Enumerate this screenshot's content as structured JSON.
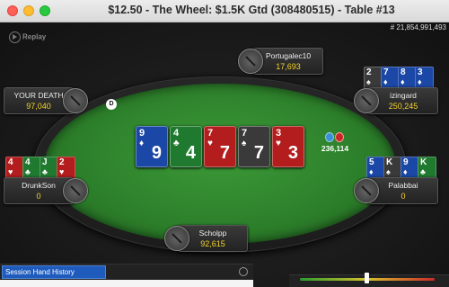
{
  "window": {
    "title": "$12.50 - The Wheel: $1.5K Gtd  (308480515) - Table #13",
    "hand_number": "# 21,854,991,493",
    "replay_label": "Replay"
  },
  "players": [
    {
      "name": "Portugalec10",
      "stack": "17,693"
    },
    {
      "name": "YOUR DEATH",
      "stack": "97,040"
    },
    {
      "name": "izingard",
      "stack": "250,245",
      "cards": [
        {
          "rank": "2",
          "suit": "spade"
        },
        {
          "rank": "7",
          "suit": "diamond"
        },
        {
          "rank": "8",
          "suit": "diamond"
        },
        {
          "rank": "3",
          "suit": "diamond"
        }
      ]
    },
    {
      "name": "DrunkSon",
      "stack": "0",
      "cards": [
        {
          "rank": "4",
          "suit": "heart"
        },
        {
          "rank": "4",
          "suit": "club"
        },
        {
          "rank": "J",
          "suit": "club"
        },
        {
          "rank": "2",
          "suit": "heart"
        }
      ]
    },
    {
      "name": "Palabbai",
      "stack": "0",
      "cards": [
        {
          "rank": "5",
          "suit": "diamond"
        },
        {
          "rank": "K",
          "suit": "spade"
        },
        {
          "rank": "9",
          "suit": "diamond"
        },
        {
          "rank": "K",
          "suit": "club"
        }
      ]
    },
    {
      "name": "Scholpp",
      "stack": "92,615"
    }
  ],
  "board": [
    {
      "rank": "9",
      "suit": "diamond"
    },
    {
      "rank": "4",
      "suit": "club"
    },
    {
      "rank": "7",
      "suit": "heart"
    },
    {
      "rank": "7",
      "suit": "spade"
    },
    {
      "rank": "3",
      "suit": "heart"
    }
  ],
  "dealer_button": "D",
  "pot": {
    "amount": "236,114"
  },
  "suit_symbols": {
    "spade": "♠",
    "heart": "♥",
    "diamond": "♦",
    "club": "♣"
  },
  "history": {
    "button_label": "Session Hand History"
  }
}
